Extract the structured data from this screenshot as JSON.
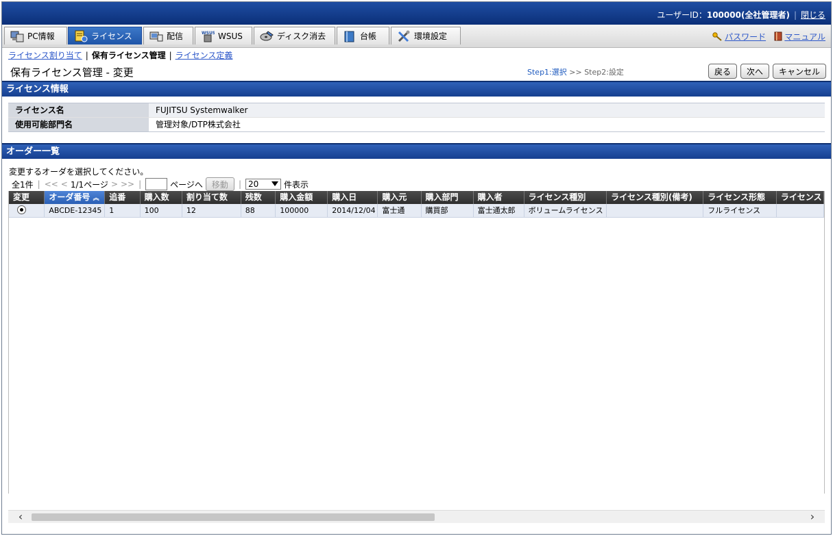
{
  "header": {
    "user_label": "ユーザーID：",
    "user_value": "100000(全社管理者)",
    "close": "閉じる"
  },
  "tabs": [
    {
      "label": "PC情報",
      "icon": "pc-icon"
    },
    {
      "label": "ライセンス",
      "icon": "license-icon"
    },
    {
      "label": "配信",
      "icon": "distribution-icon"
    },
    {
      "label": "WSUS",
      "icon": "wsus-icon"
    },
    {
      "label": "ディスク消去",
      "icon": "disk-erase-icon"
    },
    {
      "label": "台帳",
      "icon": "ledger-icon"
    },
    {
      "label": "環境設定",
      "icon": "settings-tools-icon"
    }
  ],
  "right_links": {
    "password": "パスワード",
    "manual": "マニュアル"
  },
  "subnav": {
    "assign": "ライセンス割り当て",
    "held": "保有ライセンス管理",
    "define": "ライセンス定義"
  },
  "page": {
    "title": "保有ライセンス管理 - 変更",
    "step1": "Step1:選択",
    "step_sep": ">>",
    "step2": "Step2:設定",
    "back": "戻る",
    "next": "次へ",
    "cancel": "キャンセル"
  },
  "license_info": {
    "section_title": "ライセンス情報",
    "name_label": "ライセンス名",
    "name_value": "FUJITSU Systemwalker",
    "dept_label": "使用可能部門名",
    "dept_value": "管理対象/DTP株式会社"
  },
  "orders": {
    "section_title": "オーダー一覧",
    "instruction": "変更するオーダを選択してください。",
    "total": "全1件",
    "first": "<<",
    "prev": "<",
    "page_info": "1/1ページ",
    "next": ">",
    "last": ">>",
    "page_to": "ページへ",
    "move": "移動",
    "per_page": "20",
    "per_page_suffix": "件表示",
    "columns": [
      "変更",
      "オーダ番号",
      "追番",
      "購入数",
      "割り当て数",
      "残数",
      "購入金額",
      "購入日",
      "購入元",
      "購入部門",
      "購入者",
      "ライセンス種別",
      "ライセンス種別(備考)",
      "ライセンス形態",
      "ライセンス"
    ],
    "rows": [
      [
        "",
        "ABCDE-12345",
        "1",
        "100",
        "12",
        "88",
        "100000",
        "2014/12/04",
        "富士通",
        "購買部",
        "富士通太郎",
        "ボリュームライセンス",
        "",
        "フルライセンス",
        ""
      ]
    ]
  }
}
